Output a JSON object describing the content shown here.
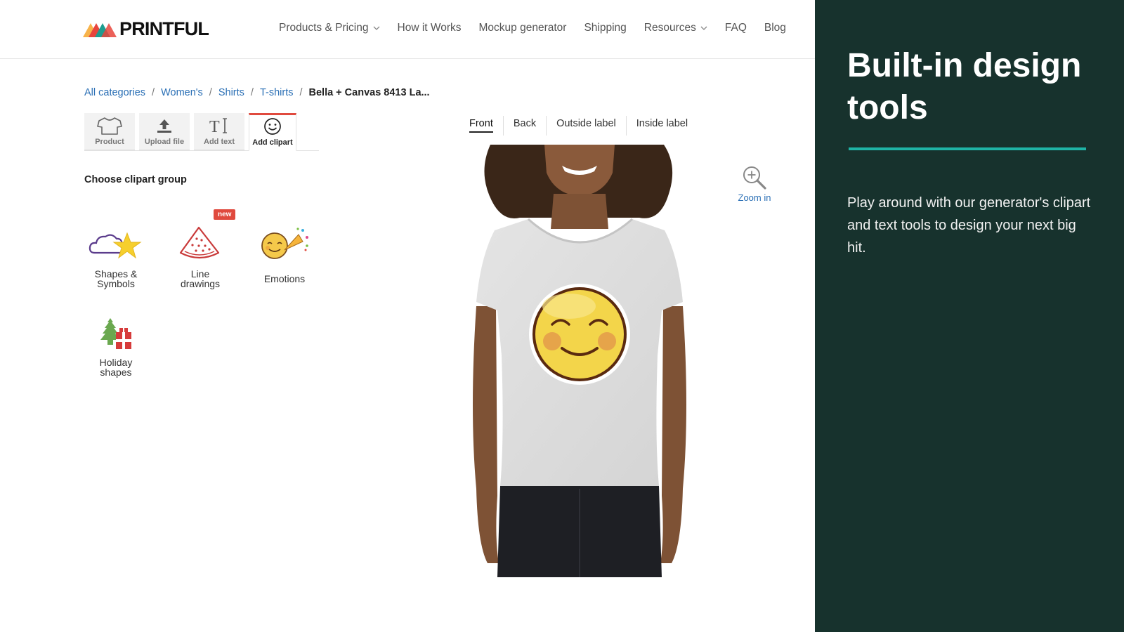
{
  "header": {
    "logo_text": "PRINTFUL",
    "nav": [
      {
        "label": "Products & Pricing",
        "has_dropdown": true
      },
      {
        "label": "How it Works",
        "has_dropdown": false
      },
      {
        "label": "Mockup generator",
        "has_dropdown": false
      },
      {
        "label": "Shipping",
        "has_dropdown": false
      },
      {
        "label": "Resources",
        "has_dropdown": true
      },
      {
        "label": "FAQ",
        "has_dropdown": false
      },
      {
        "label": "Blog",
        "has_dropdown": false
      }
    ]
  },
  "breadcrumb": {
    "items": [
      "All categories",
      "Women's",
      "Shirts",
      "T-shirts"
    ],
    "separator": "/",
    "current": "Bella + Canvas 8413 La..."
  },
  "tools": [
    {
      "label": "Product",
      "icon": "tshirt-icon",
      "active": false
    },
    {
      "label": "Upload file",
      "icon": "upload-icon",
      "active": false
    },
    {
      "label": "Add text",
      "icon": "text-icon",
      "active": false
    },
    {
      "label": "Add clipart",
      "icon": "smiley-icon",
      "active": true
    }
  ],
  "clipart": {
    "heading": "Choose clipart group",
    "badge": "new",
    "groups": [
      {
        "label": "Shapes &\nSymbols",
        "icon": "cloud-star-icon"
      },
      {
        "label": "Line\ndrawings",
        "icon": "watermelon-icon",
        "badge": "new"
      },
      {
        "label": "Emotions",
        "icon": "party-emoji-icon"
      },
      {
        "label": "Holiday\nshapes",
        "icon": "tree-gift-icon"
      }
    ]
  },
  "view_tabs": [
    {
      "label": "Front",
      "active": true
    },
    {
      "label": "Back",
      "active": false
    },
    {
      "label": "Outside label",
      "active": false
    },
    {
      "label": "Inside label",
      "active": false
    }
  ],
  "zoom": {
    "label": "Zoom in",
    "icon": "zoom-in-icon"
  },
  "side_panel": {
    "title": "Built-in design tools",
    "text": "Play around with our generator's clipart and text tools to design your next big hit."
  },
  "colors": {
    "side_bg": "#17322d",
    "accent_rule": "#1fb3a5",
    "active_tool": "#e04a3e",
    "link": "#2a6fb5"
  }
}
